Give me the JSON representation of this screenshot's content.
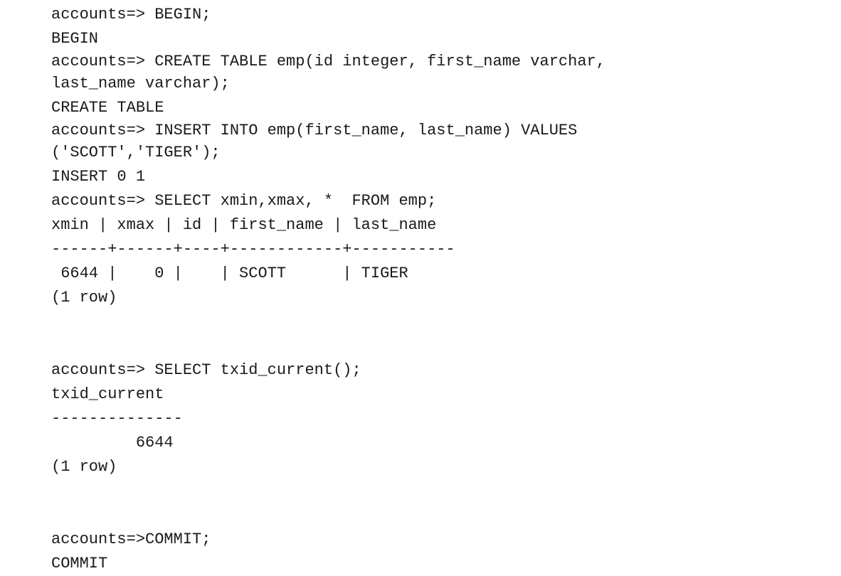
{
  "terminal": {
    "lines": [
      "accounts=> BEGIN;",
      "BEGIN",
      "accounts=> CREATE TABLE emp(id integer, first_name varchar,",
      "last_name varchar);",
      "CREATE TABLE",
      "accounts=> INSERT INTO emp(first_name, last_name) VALUES",
      "('SCOTT','TIGER');",
      "INSERT 0 1",
      "accounts=> SELECT xmin,xmax, *  FROM emp;",
      "xmin | xmax | id | first_name | last_name",
      "------+------+----+------------+-----------",
      " 6644 |    0 |    | SCOTT      | TIGER",
      "(1 row)",
      "accounts=> SELECT txid_current();",
      "txid_current",
      "--------------",
      "         6644",
      "(1 row)",
      "accounts=>COMMIT;",
      "COMMIT"
    ]
  }
}
